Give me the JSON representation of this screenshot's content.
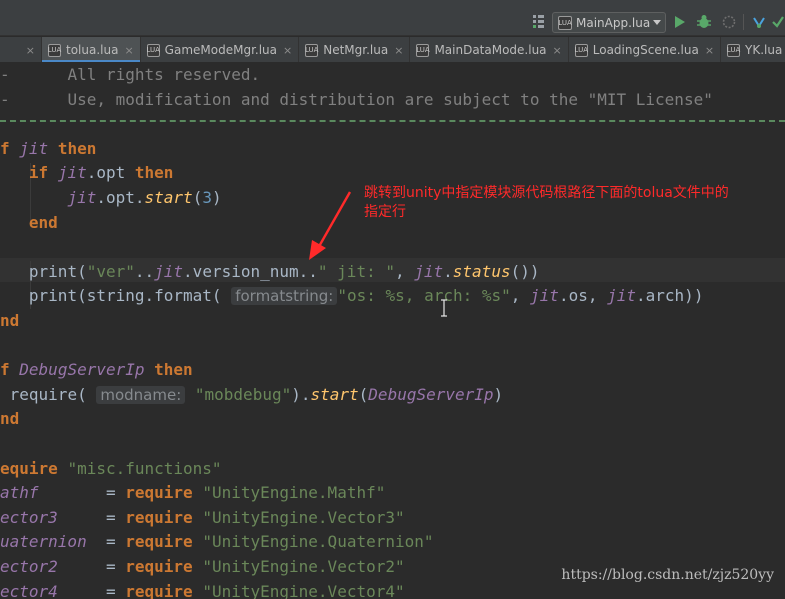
{
  "toolbar": {
    "run_config": "MainApp.lua",
    "run_config_badge": "LUA",
    "icons": [
      "build-config-icon",
      "run-icon",
      "debug-icon",
      "coverage-icon",
      "vcs-update-icon",
      "vcs-commit-icon"
    ]
  },
  "tabs": [
    {
      "label": "tolua.lua",
      "active": true
    },
    {
      "label": "GameModeMgr.lua",
      "active": false
    },
    {
      "label": "NetMgr.lua",
      "active": false
    },
    {
      "label": "MainDataMode.lua",
      "active": false
    },
    {
      "label": "LoadingScene.lua",
      "active": false
    },
    {
      "label": "YK.lua",
      "active": false
    }
  ],
  "tab_close_glyph": "×",
  "tab_badge": "LUA",
  "code": {
    "l1_dash": "-",
    "l1_text": "All rights reserved.",
    "l2_dash": "-",
    "l2_text": "Use, modification and distribution are subject to the \"MIT License\"",
    "l3_f": "f",
    "l3_jit": "jit",
    "l3_then": "then",
    "l4_if": "if",
    "l4_jit": "jit",
    "l4_opt": ".opt",
    "l4_then": "then",
    "l5_jit": "jit",
    "l5_opt": ".opt.",
    "l5_start": "start",
    "l5_open": "(",
    "l5_num": "3",
    "l5_close": ")",
    "l6_end": "end",
    "l8_print": "print(",
    "l8_str1": "\"ver\"",
    "l8_dots1": "..",
    "l8_jit": "jit",
    "l8_vn": ".version_num..",
    "l8_str2": "\" jit: \"",
    "l8_comma": ", ",
    "l8_jit2": "jit",
    "l8_dot": ".",
    "l8_status": "status",
    "l8_close": "())",
    "l9_print": "print(string.format(",
    "l9_hint": "formatstring:",
    "l9_str": "\"os: %s, arch: %s\"",
    "l9_comma1": ", ",
    "l9_jit1": "jit",
    "l9_os": ".os, ",
    "l9_jit2": "jit",
    "l9_arch": ".arch))",
    "l10_nd": "nd",
    "l12_f": "f",
    "l12_dsi": "DebugServerIp",
    "l12_then": "then",
    "l13_require": "require(",
    "l13_hint": "modname:",
    "l13_str": "\"mobdebug\"",
    "l13_close": ").",
    "l13_start": "start",
    "l13_open": "(",
    "l13_dsi": "DebugServerIp",
    "l13_end": ")",
    "l14_nd": "nd",
    "l16_equire": "equire",
    "l16_str": "\"misc.functions\"",
    "l17_name": "athf",
    "l17_eq": "=",
    "l17_req": "require",
    "l17_str": "\"UnityEngine.Mathf\"",
    "l18_name": "ector3",
    "l18_eq": "=",
    "l18_req": "require",
    "l18_str": "\"UnityEngine.Vector3\"",
    "l19_name": "uaternion",
    "l19_eq": "=",
    "l19_req": "require",
    "l19_str": "\"UnityEngine.Quaternion\"",
    "l20_name": "ector2",
    "l20_eq": "=",
    "l20_req": "require",
    "l20_str": "\"UnityEngine.Vector2\"",
    "l21_name": "ector4",
    "l21_eq": "=",
    "l21_req": "require",
    "l21_str": "\"UnityEngine.Vector4\""
  },
  "annotation": {
    "line1": "跳转到unity中指定模块源代码根路径下面的tolua文件中的",
    "line2": "指定行",
    "color": "#ff2a2a"
  },
  "watermark": "https://blog.csdn.net/zjz520yy"
}
